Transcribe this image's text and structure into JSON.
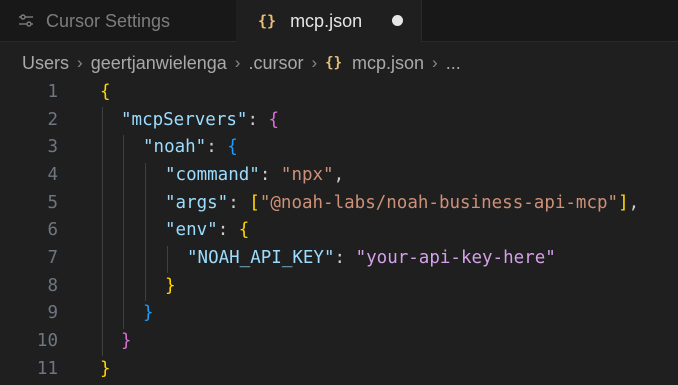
{
  "tabs": [
    {
      "label": "Cursor Settings",
      "icon": "settings-sliders-icon",
      "active": false
    },
    {
      "label": "mcp.json",
      "icon": "json-braces-icon",
      "active": true,
      "unsaved": true
    }
  ],
  "json_icon_glyph": "{}",
  "breadcrumb": {
    "items": [
      "Users",
      "geertjanwielenga",
      ".cursor",
      "mcp.json",
      "..."
    ]
  },
  "colors": {
    "background": "#1f1f1f",
    "brace_level1": "#ffd700",
    "brace_level2": "#da70d6",
    "brace_level3": "#179fff",
    "key": "#9cdcfe",
    "string": "#ce9178"
  },
  "editor": {
    "line_numbers": [
      "1",
      "2",
      "3",
      "4",
      "5",
      "6",
      "7",
      "8",
      "9",
      "10",
      "11"
    ],
    "text": {
      "open_brace": "{",
      "close_brace": "}",
      "mcpServers_key": "\"mcpServers\"",
      "noah_key": "\"noah\"",
      "command_key": "\"command\"",
      "command_value": "\"npx\"",
      "args_key": "\"args\"",
      "args_value": "\"@noah-labs/noah-business-api-mcp\"",
      "env_key": "\"env\"",
      "api_key_key": "\"NOAH_API_KEY\"",
      "api_key_value": "\"your-api-key-here\"",
      "colon": ": ",
      "comma": ",",
      "open_bracket": "[",
      "close_bracket": "]"
    }
  }
}
